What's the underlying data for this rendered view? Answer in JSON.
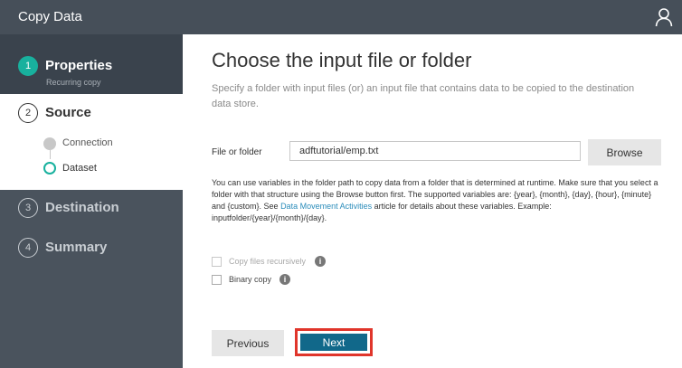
{
  "header": {
    "title": "Copy Data",
    "user_icon": "user-icon"
  },
  "sidebar": {
    "steps": [
      {
        "number": "1",
        "label": "Properties",
        "sublabel": "Recurring copy"
      },
      {
        "number": "2",
        "label": "Source",
        "substeps": [
          "Connection",
          "Dataset"
        ]
      },
      {
        "number": "3",
        "label": "Destination"
      },
      {
        "number": "4",
        "label": "Summary"
      }
    ]
  },
  "main": {
    "title": "Choose the input file or folder",
    "description": "Specify a folder with input files (or) an input file that contains data to be copied to the destination data store.",
    "field_label": "File or folder",
    "field_value": "adftutorial/emp.txt",
    "browse_label": "Browse",
    "info_text_before": "You can use variables in the folder path to copy data from a folder that is determined at runtime. Make sure that you select a folder with that structure using the Browse button first. The supported variables are: {year}, {month}, {day}, {hour}, {minute} and {custom}. See ",
    "info_link": "Data Movement Activities",
    "info_text_after": " article for details about these variables. Example: inputfolder/{year}/{month}/{day}.",
    "checkbox_recursive": "Copy files recursively",
    "checkbox_binary": "Binary copy",
    "previous_label": "Previous",
    "next_label": "Next"
  },
  "colors": {
    "accent": "#18b19e",
    "header": "#464f59",
    "sidebar": "#4a535d",
    "primary_button": "#11688a",
    "highlight": "#e0352b",
    "link": "#2a8cba"
  }
}
